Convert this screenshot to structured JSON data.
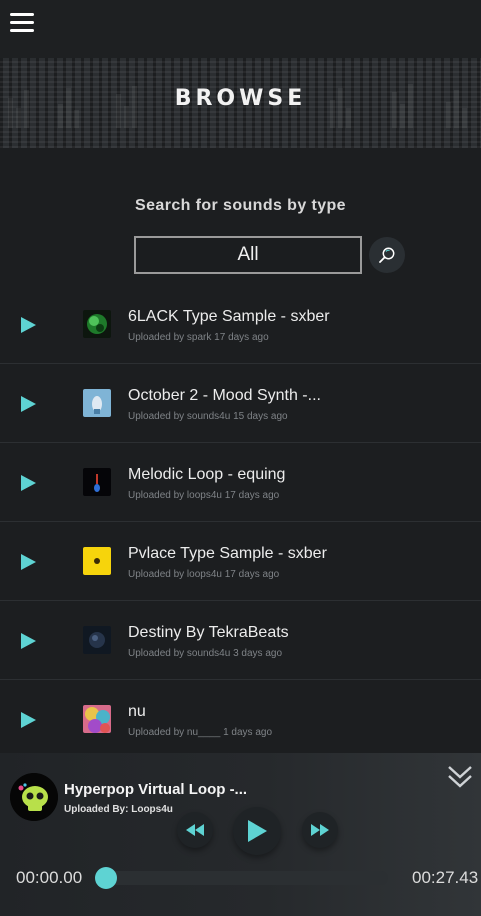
{
  "header": {
    "menu_icon": "hamburger-menu-icon"
  },
  "banner": {
    "title": "BROWSE"
  },
  "search": {
    "label": "Search for sounds by type",
    "selected_type": "All",
    "search_icon": "magnifier-icon"
  },
  "sounds": [
    {
      "title": "6LACK Type Sample - sxber",
      "meta": "Uploaded by spark 17 days ago"
    },
    {
      "title": "October 2 - Mood Synth -...",
      "meta": "Uploaded by sounds4u 15 days ago"
    },
    {
      "title": "Melodic Loop - equing",
      "meta": "Uploaded by loops4u 17 days ago"
    },
    {
      "title": "Pvlace Type Sample - sxber",
      "meta": "Uploaded by loops4u 17 days ago"
    },
    {
      "title": "Destiny By TekraBeats",
      "meta": "Uploaded by sounds4u 3 days ago"
    },
    {
      "title": "nu",
      "meta": "Uploaded by nu____ 1 days ago"
    }
  ],
  "player": {
    "title": "Hyperpop Virtual Loop -...",
    "uploader": "Uploaded By: Loops4u",
    "current_time": "00:00.00",
    "total_time": "00:27.43",
    "progress": 0,
    "controls": [
      "rewind-icon",
      "play-icon",
      "fast-forward-icon"
    ],
    "collapse_icon": "double-chevron-down-icon"
  },
  "colors": {
    "accent": "#5ed3d3",
    "background": "#1c1e20",
    "row_divider": "#2c2f32"
  }
}
